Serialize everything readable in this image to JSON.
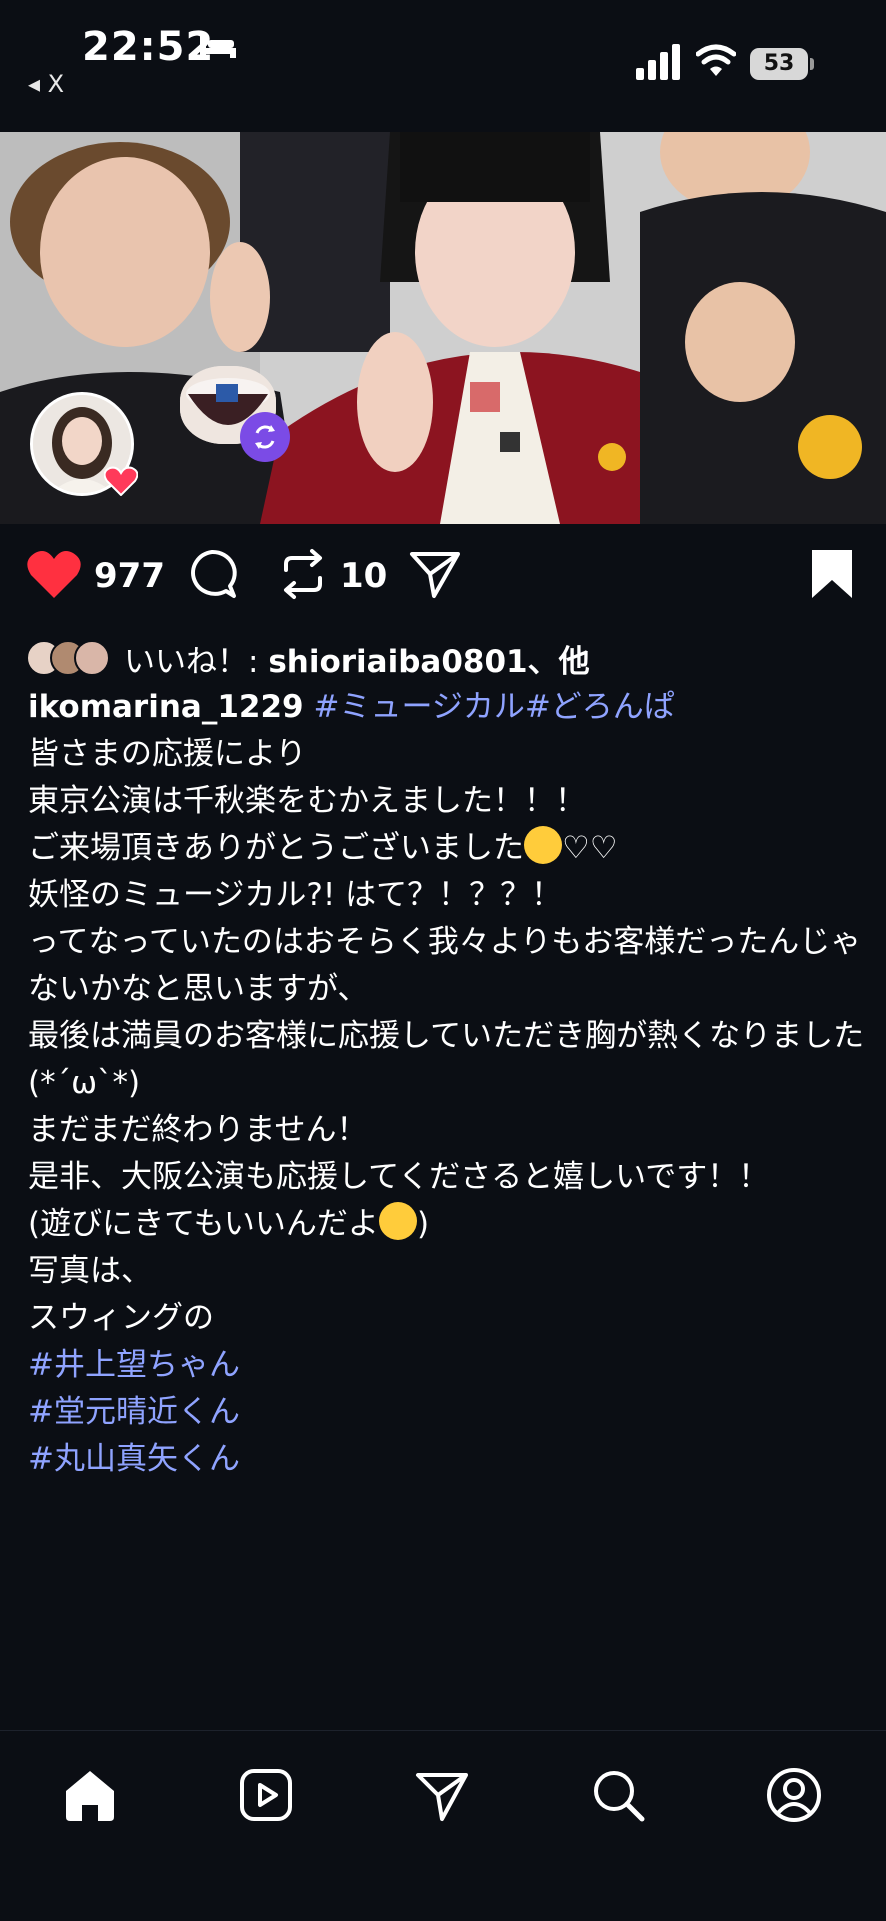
{
  "status_bar": {
    "time": "22:52",
    "back_label": "◂ X",
    "battery": "53"
  },
  "post": {
    "likes": "977",
    "reposts": "10",
    "liked_by_prefix": "いいね！: ",
    "liked_by_user": "shioriaiba0801",
    "liked_by_suffix": "、他",
    "author": "ikomarina_1229",
    "hashtags_header": "#ミュージカル#どろんぱ",
    "caption_lines": [
      "",
      "皆さまの応援により",
      "東京公演は千秋楽をむかえました！！！",
      "ご来場頂きありがとうございました",
      "",
      "妖怪のミュージカル?! はて？！？？！",
      "",
      "ってなっていたのはおそらく我々よりもお客様だったんじゃないかなと思いますが、",
      "最後は満員のお客様に応援していただき胸が熱くなりました (*´ω`*)",
      "",
      "まだまだ終わりません！",
      "是非、大阪公演も応援してくださると嬉しいです！！",
      "(遊びにきてもいいんだよ",
      "",
      "写真は、",
      "スウィングの"
    ],
    "emoji_suffix_1": "♡♡",
    "close_paren": ")",
    "hashtags_footer": [
      "#井上望ちゃん",
      "#堂元晴近くん",
      "#丸山真矢くん"
    ]
  },
  "colors": {
    "like": "#ff3040",
    "hashtag": "#8fa3ff",
    "background": "#0b0e14"
  },
  "icons": [
    "heart-icon",
    "comment-icon",
    "repost-icon",
    "share-icon",
    "bookmark-icon",
    "home-icon",
    "reels-icon",
    "send-icon",
    "search-icon",
    "profile-icon"
  ]
}
